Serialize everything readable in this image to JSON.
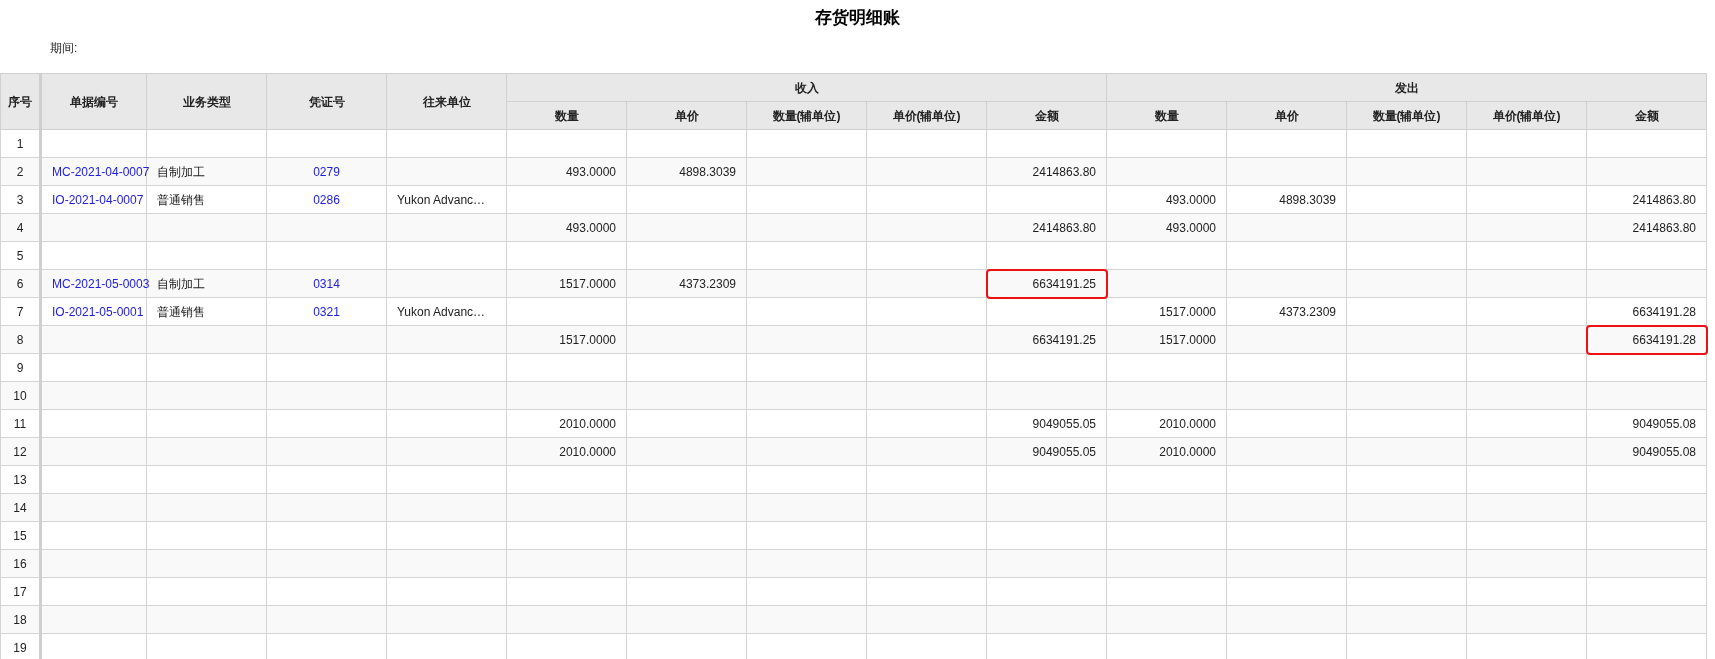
{
  "title": "存货明细账",
  "period_label": "期间:",
  "columns": {
    "no": "序号",
    "doc_no": "单据编号",
    "type": "业务类型",
    "voucher": "凭证号",
    "partner": "往来单位",
    "in_group": "收入",
    "out_group": "发出",
    "in": [
      "数量",
      "单价",
      "数量(辅单位)",
      "单价(辅单位)",
      "金额"
    ],
    "out": [
      "数量",
      "单价",
      "数量(辅单位)",
      "单价(辅单位)",
      "金额"
    ]
  },
  "rows": [
    {
      "no": "1",
      "in": {},
      "out": {},
      "in_amount_flagged": false,
      "out_amount_flagged": false
    },
    {
      "no": "2",
      "doc_no": "MC-2021-04-0007",
      "type": "自制加工",
      "voucher": "0279",
      "in": {
        "qty": "493.0000",
        "price": "4898.3039",
        "amount": "2414863.80"
      },
      "out": {},
      "in_amount_flagged": false,
      "out_amount_flagged": false
    },
    {
      "no": "3",
      "doc_no": "IO-2021-04-0007",
      "type": "普通销售",
      "voucher": "0286",
      "partner": "Yukon Advanc…",
      "in": {},
      "out": {
        "qty": "493.0000",
        "price": "4898.3039",
        "amount": "2414863.80"
      },
      "in_amount_flagged": false,
      "out_amount_flagged": false
    },
    {
      "no": "4",
      "in": {
        "qty": "493.0000",
        "amount": "2414863.80"
      },
      "out": {
        "qty": "493.0000",
        "amount": "2414863.80"
      },
      "in_amount_flagged": false,
      "out_amount_flagged": false
    },
    {
      "no": "5",
      "in": {},
      "out": {},
      "in_amount_flagged": false,
      "out_amount_flagged": false
    },
    {
      "no": "6",
      "doc_no": "MC-2021-05-0003",
      "type": "自制加工",
      "voucher": "0314",
      "in": {
        "qty": "1517.0000",
        "price": "4373.2309",
        "amount": "6634191.25"
      },
      "out": {},
      "in_amount_flagged": true,
      "out_amount_flagged": false
    },
    {
      "no": "7",
      "doc_no": "IO-2021-05-0001",
      "type": "普通销售",
      "voucher": "0321",
      "partner": "Yukon Advanc…",
      "in": {},
      "out": {
        "qty": "1517.0000",
        "price": "4373.2309",
        "amount": "6634191.28"
      },
      "in_amount_flagged": false,
      "out_amount_flagged": false
    },
    {
      "no": "8",
      "in": {
        "qty": "1517.0000",
        "amount": "6634191.25"
      },
      "out": {
        "qty": "1517.0000",
        "amount": "6634191.28"
      },
      "in_amount_flagged": false,
      "out_amount_flagged": true
    },
    {
      "no": "9",
      "in": {},
      "out": {},
      "in_amount_flagged": false,
      "out_amount_flagged": false
    },
    {
      "no": "10",
      "in": {},
      "out": {},
      "in_amount_flagged": false,
      "out_amount_flagged": false
    },
    {
      "no": "11",
      "in": {
        "qty": "2010.0000",
        "amount": "9049055.05"
      },
      "out": {
        "qty": "2010.0000",
        "amount": "9049055.08"
      },
      "in_amount_flagged": false,
      "out_amount_flagged": false
    },
    {
      "no": "12",
      "in": {
        "qty": "2010.0000",
        "amount": "9049055.05"
      },
      "out": {
        "qty": "2010.0000",
        "amount": "9049055.08"
      },
      "in_amount_flagged": false,
      "out_amount_flagged": false
    },
    {
      "no": "13",
      "in": {},
      "out": {},
      "in_amount_flagged": false,
      "out_amount_flagged": false
    },
    {
      "no": "14",
      "in": {},
      "out": {},
      "in_amount_flagged": false,
      "out_amount_flagged": false
    },
    {
      "no": "15",
      "in": {},
      "out": {},
      "in_amount_flagged": false,
      "out_amount_flagged": false
    },
    {
      "no": "16",
      "in": {},
      "out": {},
      "in_amount_flagged": false,
      "out_amount_flagged": false
    },
    {
      "no": "17",
      "in": {},
      "out": {},
      "in_amount_flagged": false,
      "out_amount_flagged": false
    },
    {
      "no": "18",
      "in": {},
      "out": {},
      "in_amount_flagged": false,
      "out_amount_flagged": false
    },
    {
      "no": "19",
      "in": {},
      "out": {},
      "in_amount_flagged": false,
      "out_amount_flagged": false
    }
  ]
}
